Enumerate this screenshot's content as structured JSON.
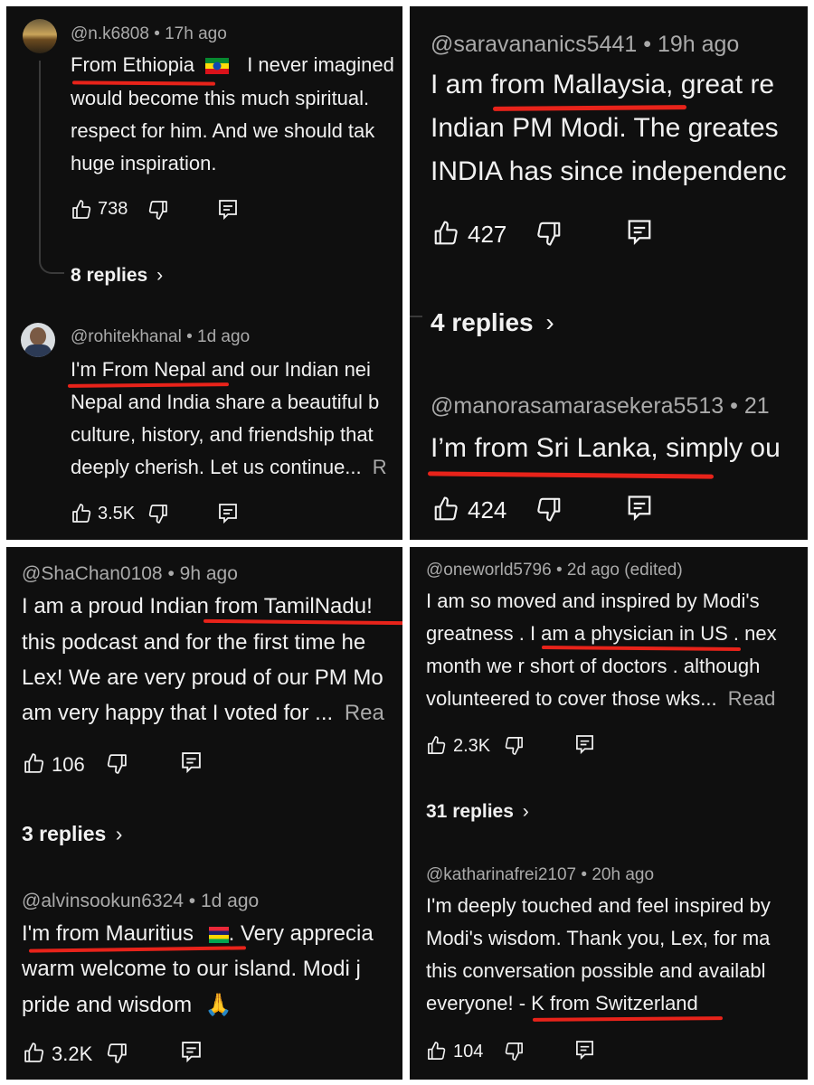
{
  "panels": [
    {
      "comments": [
        {
          "handle": "@n.k6808",
          "age": "• 17h ago",
          "lines": [
            "From Ethiopia",
            "I never imagined",
            "would become this much spiritual.",
            "respect for him. And we should tak",
            "huge inspiration."
          ],
          "flag": "ethiopia-flag",
          "likes": "738",
          "replies": "8 replies"
        },
        {
          "handle": "@rohitekhanal",
          "age": "• 1d ago",
          "lines": [
            "I'm From Nepal and  our Indian nei",
            "Nepal and India share a beautiful b",
            "culture, history, and friendship that",
            "deeply cherish. Let us continue..."
          ],
          "more": "R",
          "likes": "3.5K"
        }
      ]
    },
    {
      "comments": [
        {
          "handle": "@saravananics5441",
          "age": "• 19h ago",
          "lines": [
            "I am from Mallaysia,  great re",
            "Indian PM Modi.  The greates",
            "INDIA has since independenc"
          ],
          "likes": "427",
          "replies": "4 replies"
        },
        {
          "handle": "@manorasamarasekera5513",
          "age": "• 21",
          "lines": [
            "I’m from Sri Lanka, simply ou"
          ],
          "likes": "424"
        }
      ]
    },
    {
      "comments": [
        {
          "handle": "@ShaChan0108",
          "age": "• 9h ago",
          "lines": [
            "I am a proud Indian from TamilNadu!",
            "this podcast and for the first time he",
            "Lex! We are very proud of our PM Mo",
            "am very happy that I voted for ..."
          ],
          "more": "Rea",
          "likes": "106",
          "replies": "3 replies"
        },
        {
          "handle": "@alvinsookun6324",
          "age": "• 1d ago",
          "lines": [
            "I'm from Mauritius",
            ". Very apprecia",
            "warm welcome  to our island. Modi j",
            "pride and  wisdom"
          ],
          "flag": "mauritius-flag",
          "emoji": "🙏",
          "likes": "3.2K"
        }
      ]
    },
    {
      "comments": [
        {
          "handle": "@oneworld5796",
          "age": "• 2d ago (edited)",
          "lines": [
            "I am so moved and inspired  by Modi's",
            "greatness . I am a physician in US . nex",
            "month we r short of doctors . although",
            "volunteered to cover those wks..."
          ],
          "more": "Read",
          "likes": "2.3K",
          "replies": "31 replies"
        },
        {
          "handle": "@katharinafrei2107",
          "age": "• 20h ago",
          "lines": [
            "I'm deeply touched and feel inspired by",
            "Modi's wisdom. Thank you, Lex, for ma",
            "this conversation possible and availabl",
            "everyone! - K from Switzerland"
          ],
          "likes": "104"
        }
      ]
    }
  ],
  "colors": {
    "background": "#0f0f0f",
    "text": "#f1f1f1",
    "meta": "#aaaaaa",
    "underline": "#e8231a",
    "thread": "#3a3a3a"
  }
}
